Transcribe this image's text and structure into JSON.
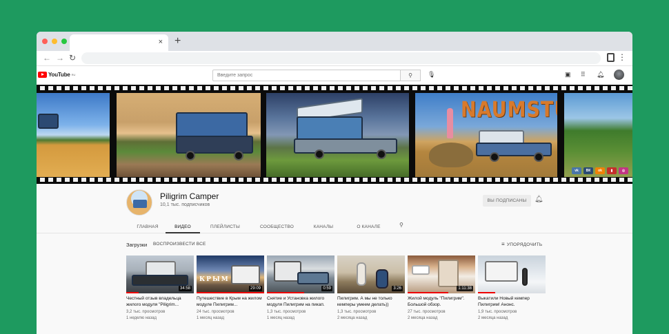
{
  "browser": {
    "dots": [
      "#ff5f57",
      "#febc2e",
      "#28c840"
    ],
    "tab_close": "×",
    "new_tab": "+"
  },
  "yt": {
    "logo_text": "YouTube",
    "logo_region": "RU",
    "search_placeholder": "Введите запрос"
  },
  "banner": {
    "studio_text": "NAUMSTUDIO",
    "socials": [
      {
        "label": "vk",
        "color": "#4a76a8"
      },
      {
        "label": "ВК",
        "color": "#2b4b73"
      },
      {
        "label": "ok",
        "color": "#ee8208"
      },
      {
        "label": "▮",
        "color": "#c4302b"
      },
      {
        "label": "◎",
        "color": "#c13584"
      }
    ]
  },
  "channel": {
    "name": "Piligrim Camper",
    "subscribers": "10,1 тыс. подписчиков",
    "subscribe_label": "ВЫ ПОДПИСАНЫ",
    "tabs": [
      {
        "label": "ГЛАВНАЯ",
        "active": false
      },
      {
        "label": "ВИДЕО",
        "active": true
      },
      {
        "label": "ПЛЕЙЛИСТЫ",
        "active": false
      },
      {
        "label": "СООБЩЕСТВО",
        "active": false
      },
      {
        "label": "КАНАЛЫ",
        "active": false
      },
      {
        "label": "О КАНАЛЕ",
        "active": false
      }
    ]
  },
  "videos": {
    "section_title": "Загрузки",
    "play_all": "ВОСПРОИЗВЕСТИ ВСЕ",
    "sort_label": "УПОРЯДОЧИТЬ",
    "items": [
      {
        "title": "Честный отзыв владельца жилого модуля \"Piligrim...",
        "views": "3,2 тыс. просмотров",
        "age": "1 неделю назад",
        "duration": "34:58",
        "progress": 0.18,
        "thumb_overlay": ""
      },
      {
        "title": "Путешествие в Крым на жилом модуле Пилигрим...",
        "views": "24 тыс. просмотров",
        "age": "1 месяц назад",
        "duration": "29:09",
        "progress": 1,
        "thumb_overlay": "КРЫМ"
      },
      {
        "title": "Снятие и Установка жилого модуля Пилигрим на пикап.",
        "views": "1,3 тыс. просмотров",
        "age": "1 месяц назад",
        "duration": "0:59",
        "progress": 0.55,
        "thumb_overlay": ""
      },
      {
        "title": "Пилигрим. А мы не только кемперы умеем делать))",
        "views": "1,3 тыс. просмотров",
        "age": "2 месяца назад",
        "duration": "3:26",
        "progress": 0,
        "thumb_overlay": ""
      },
      {
        "title": "Жилой модуль \"Пилигрим\". Большой обзор.",
        "views": "27 тыс. просмотров",
        "age": "2 месяца назад",
        "duration": "1:11:38",
        "progress": 0.6,
        "thumb_overlay": ""
      },
      {
        "title": "Выкатили Новый кемпер Пилигрим! Анонс.",
        "views": "1,9 тыс. просмотров",
        "age": "2 месяца назад",
        "duration": "",
        "progress": 0.25,
        "thumb_overlay": ""
      }
    ]
  }
}
